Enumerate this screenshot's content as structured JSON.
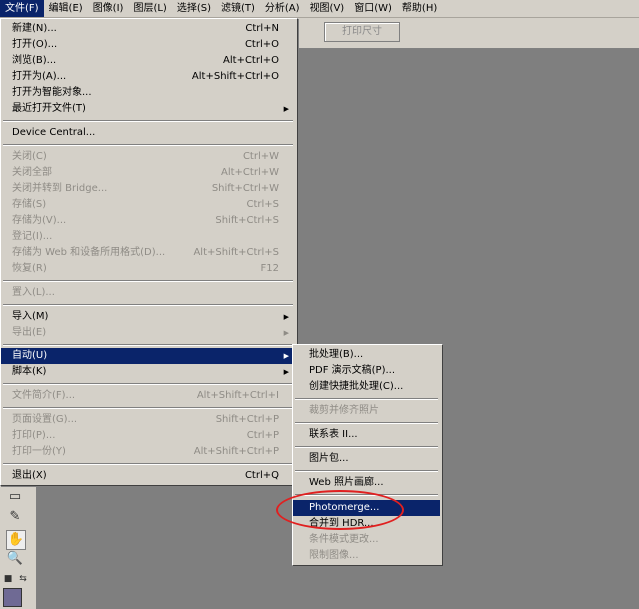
{
  "menubar": [
    "文件(F)",
    "编辑(E)",
    "图像(I)",
    "图层(L)",
    "选择(S)",
    "滤镜(T)",
    "分析(A)",
    "视图(V)",
    "窗口(W)",
    "帮助(H)"
  ],
  "options_bar": {
    "print_size_button": "打印尺寸"
  },
  "file_menu": {
    "new": {
      "label": "新建(N)...",
      "shortcut": "Ctrl+N"
    },
    "open": {
      "label": "打开(O)...",
      "shortcut": "Ctrl+O"
    },
    "browse": {
      "label": "浏览(B)...",
      "shortcut": "Alt+Ctrl+O"
    },
    "open_as": {
      "label": "打开为(A)...",
      "shortcut": "Alt+Shift+Ctrl+O"
    },
    "open_smart": {
      "label": "打开为智能对象..."
    },
    "recent": {
      "label": "最近打开文件(T)"
    },
    "device_central": {
      "label": "Device Central..."
    },
    "close": {
      "label": "关闭(C)",
      "shortcut": "Ctrl+W"
    },
    "close_all": {
      "label": "关闭全部",
      "shortcut": "Alt+Ctrl+W"
    },
    "close_bridge": {
      "label": "关闭并转到 Bridge...",
      "shortcut": "Shift+Ctrl+W"
    },
    "save": {
      "label": "存储(S)",
      "shortcut": "Ctrl+S"
    },
    "save_as": {
      "label": "存储为(V)...",
      "shortcut": "Shift+Ctrl+S"
    },
    "checkin": {
      "label": "登记(I)..."
    },
    "save_web": {
      "label": "存储为 Web 和设备所用格式(D)...",
      "shortcut": "Alt+Shift+Ctrl+S"
    },
    "revert": {
      "label": "恢复(R)",
      "shortcut": "F12"
    },
    "place": {
      "label": "置入(L)..."
    },
    "import": {
      "label": "导入(M)"
    },
    "export": {
      "label": "导出(E)"
    },
    "automate": {
      "label": "自动(U)"
    },
    "scripts": {
      "label": "脚本(K)"
    },
    "file_info": {
      "label": "文件简介(F)...",
      "shortcut": "Alt+Shift+Ctrl+I"
    },
    "page_setup": {
      "label": "页面设置(G)...",
      "shortcut": "Shift+Ctrl+P"
    },
    "print": {
      "label": "打印(P)...",
      "shortcut": "Ctrl+P"
    },
    "print_one": {
      "label": "打印一份(Y)",
      "shortcut": "Alt+Shift+Ctrl+P"
    },
    "exit": {
      "label": "退出(X)",
      "shortcut": "Ctrl+Q"
    }
  },
  "automate_menu": {
    "batch": "批处理(B)...",
    "pdf": "PDF 演示文稿(P)...",
    "droplet": "创建快捷批处理(C)...",
    "crop": "裁剪并修齐照片",
    "contact": "联系表 II...",
    "picture_package": "图片包...",
    "web_gallery": "Web 照片画廊...",
    "photomerge": "Photomerge...",
    "hdr": "合并到 HDR...",
    "cond_mode": "条件模式更改...",
    "fit_image": "限制图像..."
  },
  "colors": {
    "highlight": "#0a246a",
    "annotation": "#e02020",
    "foreground_swatch": "#6f6a94"
  },
  "icons": [
    "notes-tool-icon",
    "eyedropper-icon",
    "hand-tool-icon",
    "zoom-icon",
    "default-colors-icon",
    "swap-colors-icon",
    "submenu-arrow-icon"
  ]
}
